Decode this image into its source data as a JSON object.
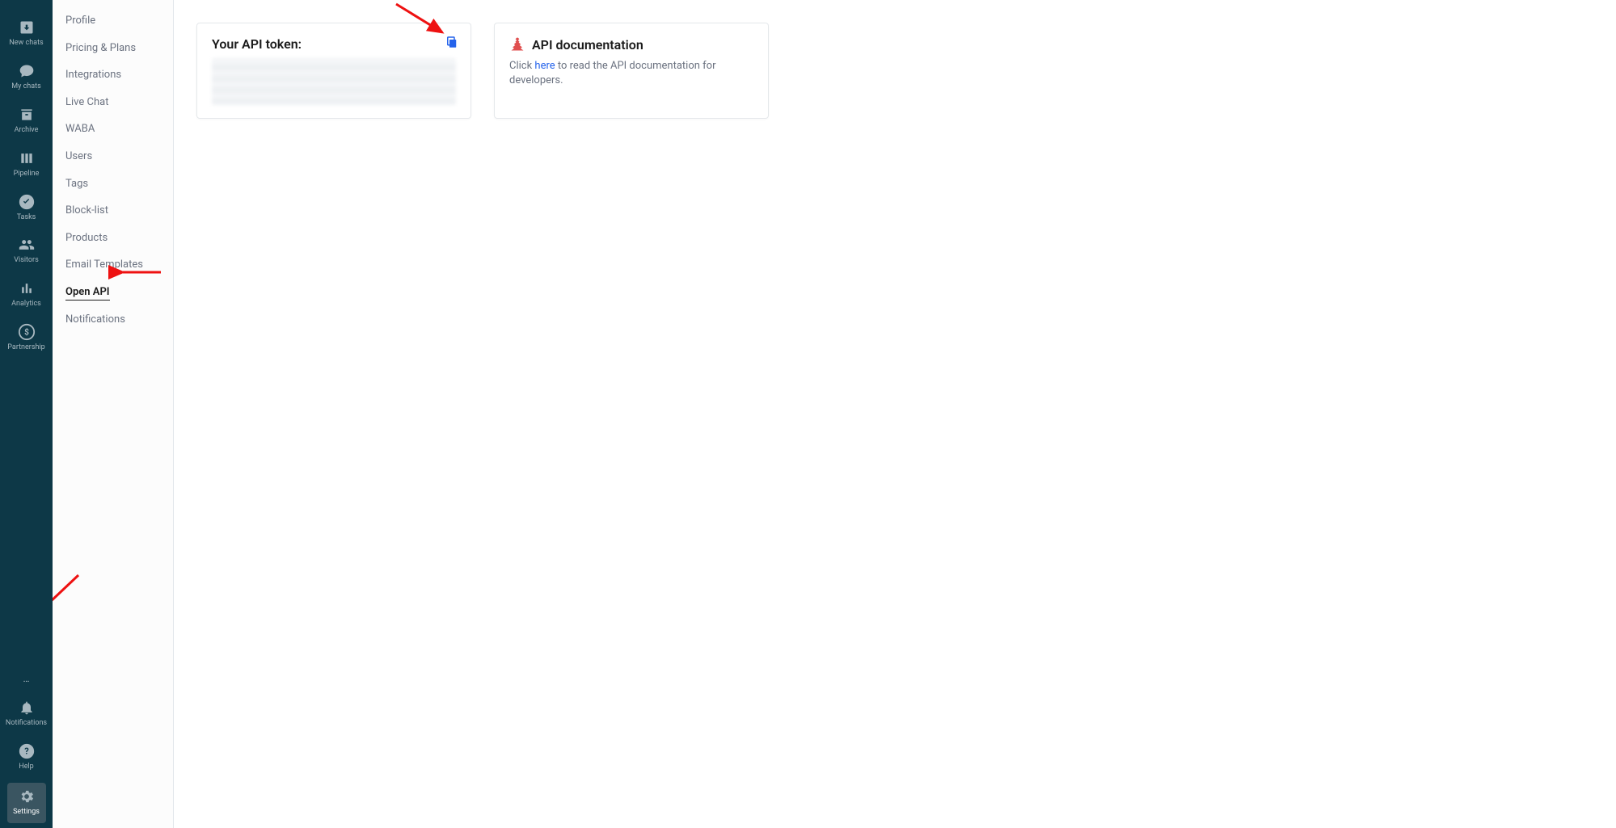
{
  "primary_nav": {
    "items": [
      {
        "label": "New chats",
        "icon": "download-icon"
      },
      {
        "label": "My chats",
        "icon": "chat-icon"
      },
      {
        "label": "Archive",
        "icon": "archive-icon"
      },
      {
        "label": "Pipeline",
        "icon": "pipeline-icon"
      },
      {
        "label": "Tasks",
        "icon": "check-circle-icon"
      },
      {
        "label": "Visitors",
        "icon": "users-icon"
      },
      {
        "label": "Analytics",
        "icon": "bar-chart-icon"
      },
      {
        "label": "Partnership",
        "icon": "dollar-circle-icon"
      }
    ],
    "more_label": "…",
    "footer": [
      {
        "label": "Notifications",
        "icon": "bell-icon"
      },
      {
        "label": "Help",
        "icon": "question-circle-icon"
      },
      {
        "label": "Settings",
        "icon": "gear-icon",
        "active": true
      }
    ]
  },
  "settings_nav": {
    "items": [
      {
        "label": "Profile"
      },
      {
        "label": "Pricing & Plans"
      },
      {
        "label": "Integrations"
      },
      {
        "label": "Live Chat"
      },
      {
        "label": "WABA"
      },
      {
        "label": "Users"
      },
      {
        "label": "Tags"
      },
      {
        "label": "Block-list"
      },
      {
        "label": "Products"
      },
      {
        "label": "Email Templates"
      },
      {
        "label": "Open API",
        "active": true
      },
      {
        "label": "Notifications"
      }
    ]
  },
  "main": {
    "token_card": {
      "title": "Your API token:",
      "copy_label": "Copy"
    },
    "doc_card": {
      "title": "API documentation",
      "text_prefix": "Click ",
      "link_text": "here",
      "text_suffix": " to read the API documentation for developers."
    }
  }
}
